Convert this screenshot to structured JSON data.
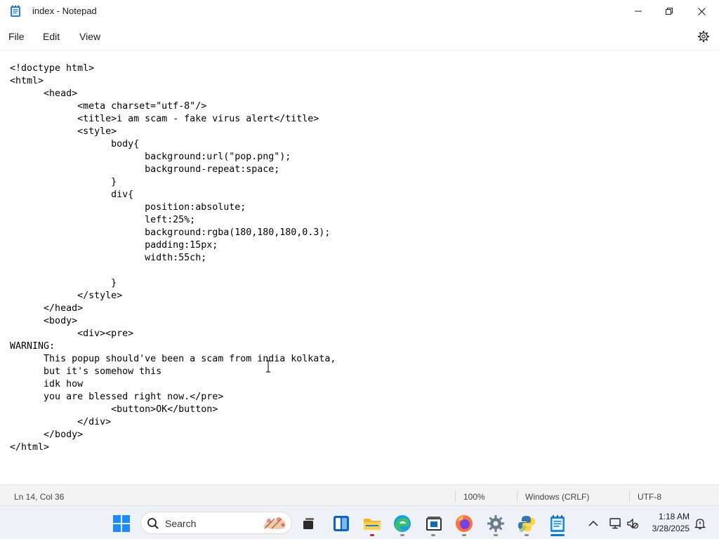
{
  "window": {
    "title": "index - Notepad",
    "app_icon": "notepad-icon",
    "controls": {
      "minimize": "minimize-icon",
      "maximize": "maximize-icon",
      "close": "close-icon"
    }
  },
  "menu": {
    "file": "File",
    "edit": "Edit",
    "view": "View",
    "settings_icon": "gear-icon"
  },
  "editor": {
    "content": "<!doctype html>\n<html>\n\t<head>\n\t\t<meta charset=\"utf-8\"/>\n\t\t<title>i am scam - fake virus alert</title>\n\t\t<style>\n\t\t\tbody{\n\t\t\t\tbackground:url(\"pop.png\");\n\t\t\t\tbackground-repeat:space;\n\t\t\t}\n\t\t\tdiv{\n\t\t\t\tposition:absolute;\n\t\t\t\tleft:25%;\n\t\t\t\tbackground:rgba(180,180,180,0.3);\n\t\t\t\tpadding:15px;\n\t\t\t\twidth:55ch;\n\n\t\t\t}\n\t\t</style>\n\t</head>\n\t<body>\n\t\t<div><pre>\nWARNING:\n\tThis popup should've been a scam from india kolkata,\n\tbut it's somehow this\n\tidk how\n\tyou are blessed right now.</pre>\n\t\t\t<button>OK</button>\n\t\t</div>\n\t</body>\n</html>"
  },
  "status": {
    "position": "Ln 14, Col 36",
    "zoom": "100%",
    "line_ending": "Windows (CRLF)",
    "encoding": "UTF-8"
  },
  "taskbar": {
    "search_placeholder": "Search",
    "time": "1:18 AM",
    "date": "3/28/2025",
    "icons": [
      "windows-start-icon",
      "search-icon",
      "task-view-icon",
      "widgets-icon",
      "file-explorer-icon",
      "edge-icon",
      "store-icon",
      "firefox-icon",
      "settings-icon",
      "python-idle-icon",
      "notepad-icon"
    ],
    "colors": {
      "accent_blue": "#0078d4",
      "taskbar_bg": "#eef1f6"
    }
  }
}
